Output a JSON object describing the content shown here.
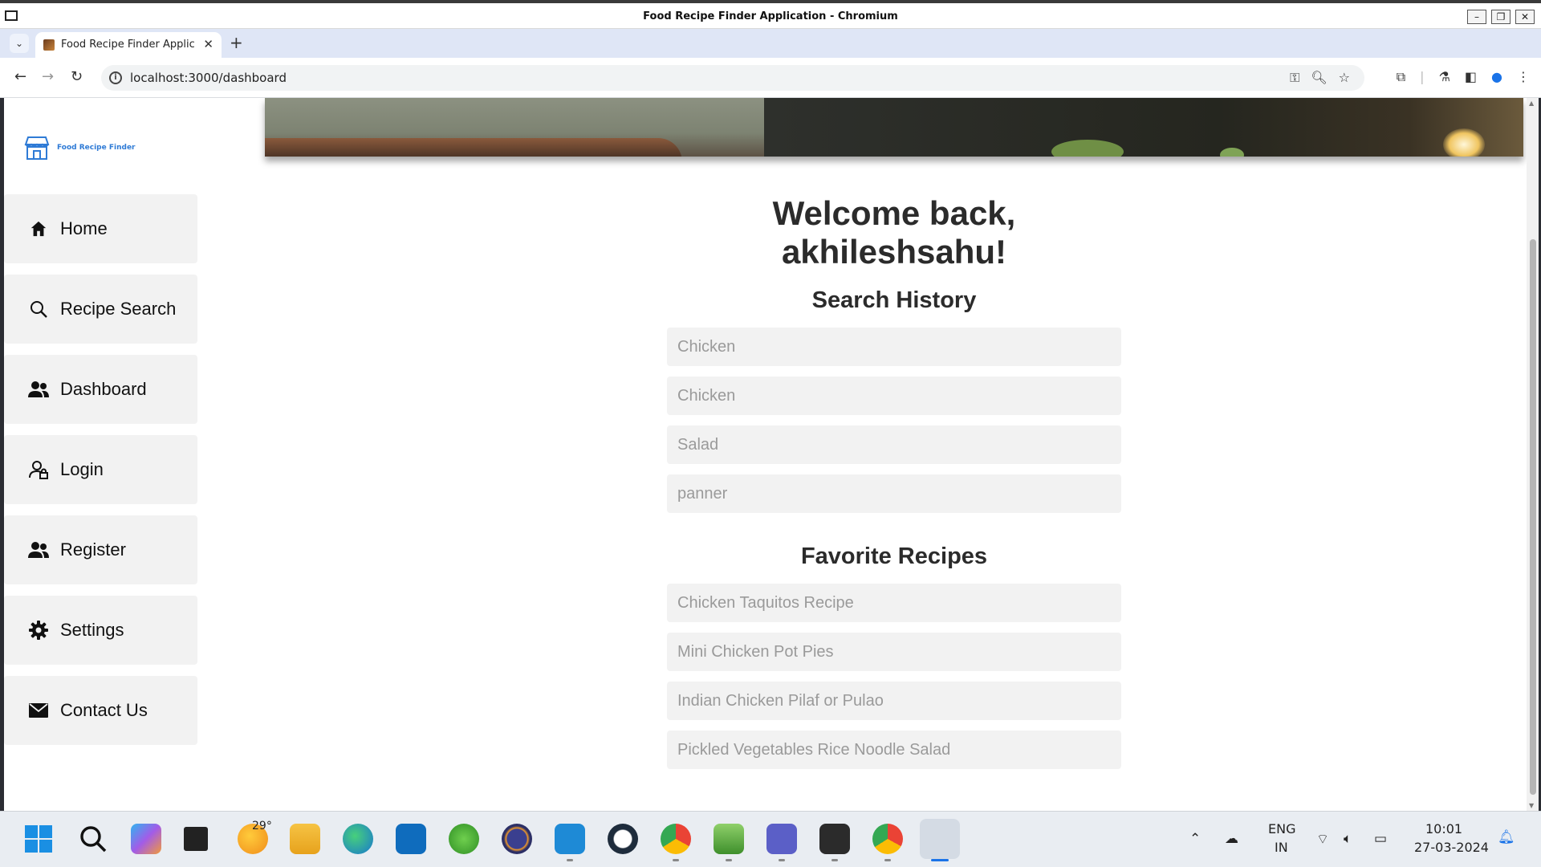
{
  "window": {
    "title": "Food Recipe Finder Application - Chromium",
    "controls": [
      "–",
      "❐",
      "✕"
    ]
  },
  "browser": {
    "tab_title": "Food Recipe Finder Applic",
    "url": "localhost:3000/dashboard",
    "new_tab": "+",
    "tab_close": "✕"
  },
  "sidebar": {
    "brand": "Food Recipe Finder",
    "items": [
      {
        "label": "Home",
        "icon": "home-icon"
      },
      {
        "label": "Recipe Search",
        "icon": "search-icon"
      },
      {
        "label": "Dashboard",
        "icon": "users-icon"
      },
      {
        "label": "Login",
        "icon": "user-lock-icon"
      },
      {
        "label": "Register",
        "icon": "users-icon"
      },
      {
        "label": "Settings",
        "icon": "gear-icon"
      },
      {
        "label": "Contact Us",
        "icon": "envelope-icon"
      }
    ]
  },
  "main": {
    "welcome": "Welcome back, akhileshsahu!",
    "search_history_title": "Search History",
    "search_history": [
      "Chicken",
      "Chicken",
      "Salad",
      "panner"
    ],
    "favorites_title": "Favorite Recipes",
    "favorites": [
      "Chicken Taquitos Recipe",
      "Mini Chicken Pot Pies",
      "Indian Chicken Pilaf or Pulao",
      "Pickled Vegetables Rice Noodle Salad"
    ]
  },
  "taskbar": {
    "weather_temp": "29°",
    "language": "ENG",
    "region": "IN",
    "time": "10:01",
    "date": "27-03-2024"
  },
  "colors": {
    "brand_blue": "#2f7bd6",
    "nav_bg": "#f2f2f2",
    "text_dark": "#2b2b2b",
    "placeholder_gray": "#9a9a9a"
  }
}
